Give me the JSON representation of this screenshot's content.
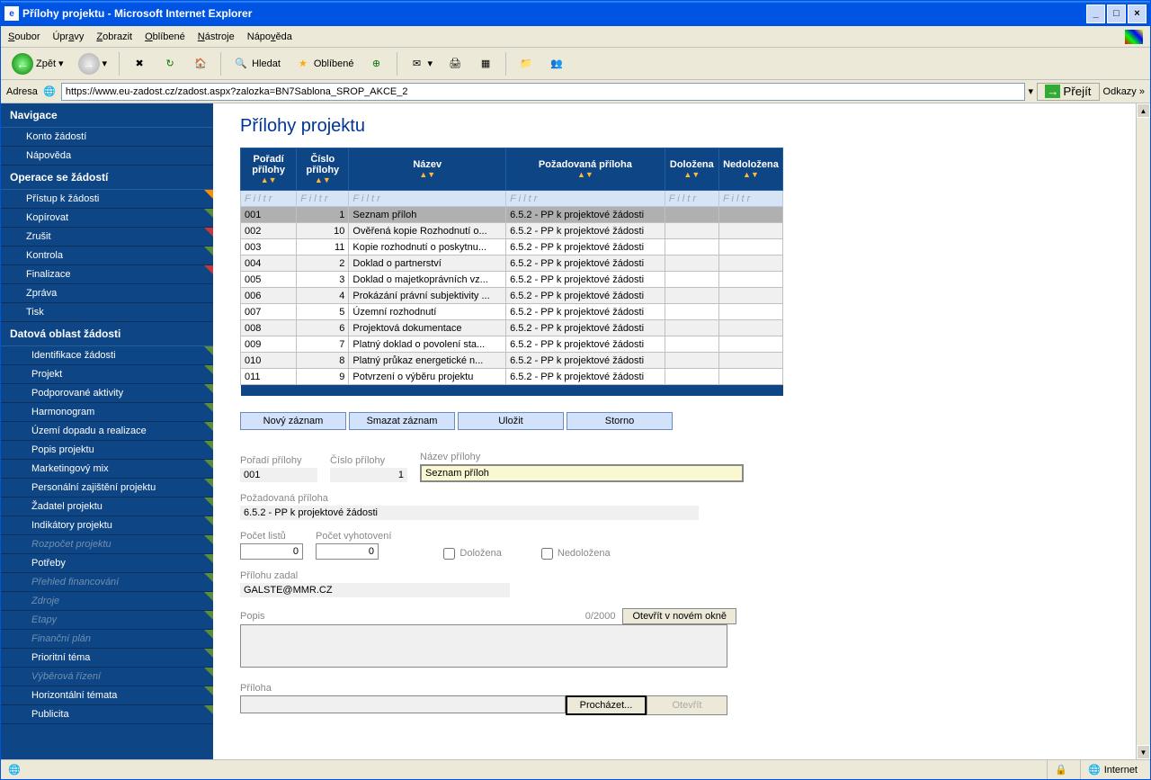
{
  "window": {
    "title": "Přílohy projektu - Microsoft Internet Explorer"
  },
  "menu": {
    "items": [
      "Soubor",
      "Úpravy",
      "Zobrazit",
      "Oblíbené",
      "Nástroje",
      "Nápověda"
    ]
  },
  "toolbar": {
    "back": "Zpět",
    "search": "Hledat",
    "favorites": "Oblíbené"
  },
  "addressbar": {
    "label": "Adresa",
    "url": "https://www.eu-zadost.cz/zadost.aspx?zalozka=BN7Sablona_SROP_AKCE_2",
    "go": "Přejít",
    "links": "Odkazy"
  },
  "sidebar": {
    "sections": [
      {
        "header": "Navigace",
        "items": [
          {
            "label": "Konto žádostí",
            "corner": null
          },
          {
            "label": "Nápověda",
            "corner": null
          }
        ]
      },
      {
        "header": "Operace se žádostí",
        "items": [
          {
            "label": "Přístup k žádosti",
            "corner": "o"
          },
          {
            "label": "Kopírovat",
            "corner": "g"
          },
          {
            "label": "Zrušit",
            "corner": "r"
          },
          {
            "label": "Kontrola",
            "corner": "g"
          },
          {
            "label": "Finalizace",
            "corner": "r"
          },
          {
            "label": "Zpráva",
            "corner": null
          },
          {
            "label": "Tisk",
            "corner": null
          }
        ]
      },
      {
        "header": "Datová oblast žádosti",
        "items": [
          {
            "label": "Identifikace žádosti",
            "corner": "g",
            "sub": true
          },
          {
            "label": "Projekt",
            "corner": "g",
            "sub": true
          },
          {
            "label": "Podporované aktivity",
            "corner": "g",
            "sub": true
          },
          {
            "label": "Harmonogram",
            "corner": "g",
            "sub": true
          },
          {
            "label": "Území dopadu a realizace",
            "corner": "g",
            "sub": true
          },
          {
            "label": "Popis projektu",
            "corner": "g",
            "sub": true
          },
          {
            "label": "Marketingový mix",
            "corner": "g",
            "sub": true
          },
          {
            "label": "Personální zajištění projektu",
            "corner": "g",
            "sub": true
          },
          {
            "label": "Žadatel projektu",
            "corner": "g",
            "sub": true
          },
          {
            "label": "Indikátory projektu",
            "corner": "g",
            "sub": true
          },
          {
            "label": "Rozpočet projektu",
            "corner": "g",
            "sub": true,
            "dim": true
          },
          {
            "label": "Potřeby",
            "corner": "g",
            "sub": true
          },
          {
            "label": "Přehled financování",
            "corner": "g",
            "sub": true,
            "dim": true
          },
          {
            "label": "Zdroje",
            "corner": "g",
            "sub": true,
            "dim": true
          },
          {
            "label": "Etapy",
            "corner": "g",
            "sub": true,
            "dim": true
          },
          {
            "label": "Finanční plán",
            "corner": "g",
            "sub": true,
            "dim": true
          },
          {
            "label": "Prioritní téma",
            "corner": "g",
            "sub": true
          },
          {
            "label": "Výběrová řízení",
            "corner": "g",
            "sub": true,
            "dim": true
          },
          {
            "label": "Horizontální témata",
            "corner": "g",
            "sub": true
          },
          {
            "label": "Publicita",
            "corner": "g",
            "sub": true
          }
        ]
      }
    ]
  },
  "page": {
    "title": "Přílohy projektu",
    "columns": {
      "c1": "Pořadí přílohy",
      "c2": "Číslo přílohy",
      "c3": "Název",
      "c4": "Požadovaná příloha",
      "c5": "Doložena",
      "c6": "Nedoložena",
      "filter": "F i l t r"
    },
    "rows": [
      {
        "poradi": "001",
        "cislo": "1",
        "nazev": "Seznam příloh",
        "poz": "6.5.2 - PP k projektové žádosti",
        "dol": "",
        "nedol": "",
        "sel": true
      },
      {
        "poradi": "002",
        "cislo": "10",
        "nazev": "Ověřená kopie Rozhodnutí o...",
        "poz": "6.5.2 - PP k projektové žádosti",
        "dol": "",
        "nedol": ""
      },
      {
        "poradi": "003",
        "cislo": "11",
        "nazev": "Kopie rozhodnutí o poskytnu...",
        "poz": "6.5.2 - PP k projektové žádosti",
        "dol": "",
        "nedol": ""
      },
      {
        "poradi": "004",
        "cislo": "2",
        "nazev": "Doklad o partnerství",
        "poz": "6.5.2 - PP k projektové žádosti",
        "dol": "",
        "nedol": ""
      },
      {
        "poradi": "005",
        "cislo": "3",
        "nazev": "Doklad o majetkoprávních vz...",
        "poz": "6.5.2 - PP k projektové žádosti",
        "dol": "",
        "nedol": ""
      },
      {
        "poradi": "006",
        "cislo": "4",
        "nazev": "Prokázání právní subjektivity ...",
        "poz": "6.5.2 - PP k projektové žádosti",
        "dol": "",
        "nedol": ""
      },
      {
        "poradi": "007",
        "cislo": "5",
        "nazev": "Územní rozhodnutí",
        "poz": "6.5.2 - PP k projektové žádosti",
        "dol": "",
        "nedol": ""
      },
      {
        "poradi": "008",
        "cislo": "6",
        "nazev": "Projektová dokumentace",
        "poz": "6.5.2 - PP k projektové žádosti",
        "dol": "",
        "nedol": ""
      },
      {
        "poradi": "009",
        "cislo": "7",
        "nazev": "Platný doklad o povolení sta...",
        "poz": "6.5.2 - PP k projektové žádosti",
        "dol": "",
        "nedol": ""
      },
      {
        "poradi": "010",
        "cislo": "8",
        "nazev": "Platný průkaz energetické n...",
        "poz": "6.5.2 - PP k projektové žádosti",
        "dol": "",
        "nedol": ""
      },
      {
        "poradi": "011",
        "cislo": "9",
        "nazev": "Potvrzení o výběru projektu",
        "poz": "6.5.2 - PP k projektové žádosti",
        "dol": "",
        "nedol": ""
      }
    ],
    "buttons": {
      "new": "Nový záznam",
      "delete": "Smazat záznam",
      "save": "Uložit",
      "cancel": "Storno"
    },
    "form": {
      "poradi_lbl": "Pořadí přílohy",
      "poradi": "001",
      "cislo_lbl": "Číslo přílohy",
      "cislo": "1",
      "nazev_lbl": "Název přílohy",
      "nazev": "Seznam příloh",
      "poz_lbl": "Požadovaná příloha",
      "poz": "6.5.2 - PP k projektové žádosti",
      "listu_lbl": "Počet listů",
      "listu": "0",
      "vyhot_lbl": "Počet vyhotovení",
      "vyhot": "0",
      "dolozena": "Doložena",
      "nedolozena": "Nedoložena",
      "zadal_lbl": "Přílohu zadal",
      "zadal": "GALSTE@MMR.CZ",
      "popis_lbl": "Popis",
      "popis_count": "0/2000",
      "popis_btn": "Otevřít v novém okně",
      "priloha_lbl": "Příloha",
      "browse": "Procházet...",
      "open": "Otevřít"
    }
  },
  "status": {
    "zone": "Internet"
  }
}
